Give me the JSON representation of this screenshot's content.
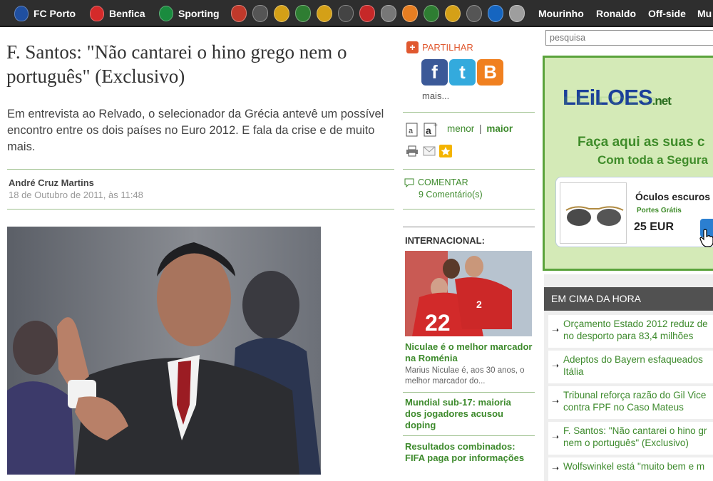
{
  "nav": {
    "clubs": [
      {
        "label": "FC Porto",
        "icon": "fc-porto-crest-icon",
        "color": "#1f4fa0"
      },
      {
        "label": "Benfica",
        "icon": "benfica-crest-icon",
        "color": "#d42a2a"
      },
      {
        "label": "Sporting",
        "icon": "sporting-crest-icon",
        "color": "#1a8b3e"
      }
    ],
    "badge_colors": [
      "#c0392b",
      "#555555",
      "#d4a017",
      "#2e7d32",
      "#d4a017",
      "#444444",
      "#c62828",
      "#777777",
      "#e67e22",
      "#2e7d32",
      "#d4a017",
      "#555555",
      "#1565c0",
      "#9e9e9e"
    ],
    "links": [
      "Mourinho",
      "Ronaldo",
      "Off-side",
      "Mu"
    ]
  },
  "article": {
    "headline": "F. Santos: \"Não cantarei o hino grego nem o português\" (Exclusivo)",
    "lead": "Em entrevista ao Relvado, o selecionador da Grécia antevê um possível encontro entre os dois países no Euro 2012. E fala da crise e de muito mais.",
    "author": "André Cruz Martins",
    "date": "18 de Outubro de 2011, às 11:48"
  },
  "share": {
    "label": "PARTILHAR",
    "more": "mais...",
    "networks": [
      {
        "name": "facebook",
        "glyph": "f",
        "color": "#3b5998"
      },
      {
        "name": "twitter",
        "glyph": "t",
        "color": "#33aadd"
      },
      {
        "name": "blogger",
        "glyph": "B",
        "color": "#f08020"
      }
    ]
  },
  "tools": {
    "font_smaller": "menor",
    "separator": "|",
    "font_bigger": "maior"
  },
  "comments": {
    "label": "COMENTAR",
    "count": "9 Comentário(s)"
  },
  "international": {
    "section_title": "INTERNACIONAL:",
    "stories": [
      {
        "title": "Niculae é o melhor marcador na Roménia",
        "summary": "Marius Niculae é, aos 30 anos, o melhor marcador do..."
      },
      {
        "title": "Mundial sub-17: maioria dos jogadores acusou doping",
        "summary": ""
      },
      {
        "title": "Resultados combinados: FIFA paga por informações",
        "summary": ""
      }
    ]
  },
  "search": {
    "placeholder": "pesquisa"
  },
  "ad": {
    "logo_main": "LEiLOES",
    "logo_suffix": ".net",
    "line1": "Faça aqui as suas c",
    "line2": "Com toda a Segura",
    "product_name": "Óculos escuros",
    "shipping": "Portes Grátis",
    "price": "25 EUR"
  },
  "latest": {
    "title": "EM CIMA DA HORA",
    "items": [
      {
        "line1": "Orçamento Estado 2012 reduz de",
        "line2": "no desporto para 83,4 milhões"
      },
      {
        "line1": "Adeptos do Bayern esfaqueados",
        "line2": "Itália"
      },
      {
        "line1": "Tribunal reforça razão do Gil Vice",
        "line2": "contra FPF no Caso Mateus"
      },
      {
        "line1": "F. Santos: \"Não cantarei o hino gr",
        "line2": "nem o português\" (Exclusivo)"
      },
      {
        "line1": "Wolfswinkel está \"muito bem e m",
        "line2": ""
      }
    ]
  }
}
